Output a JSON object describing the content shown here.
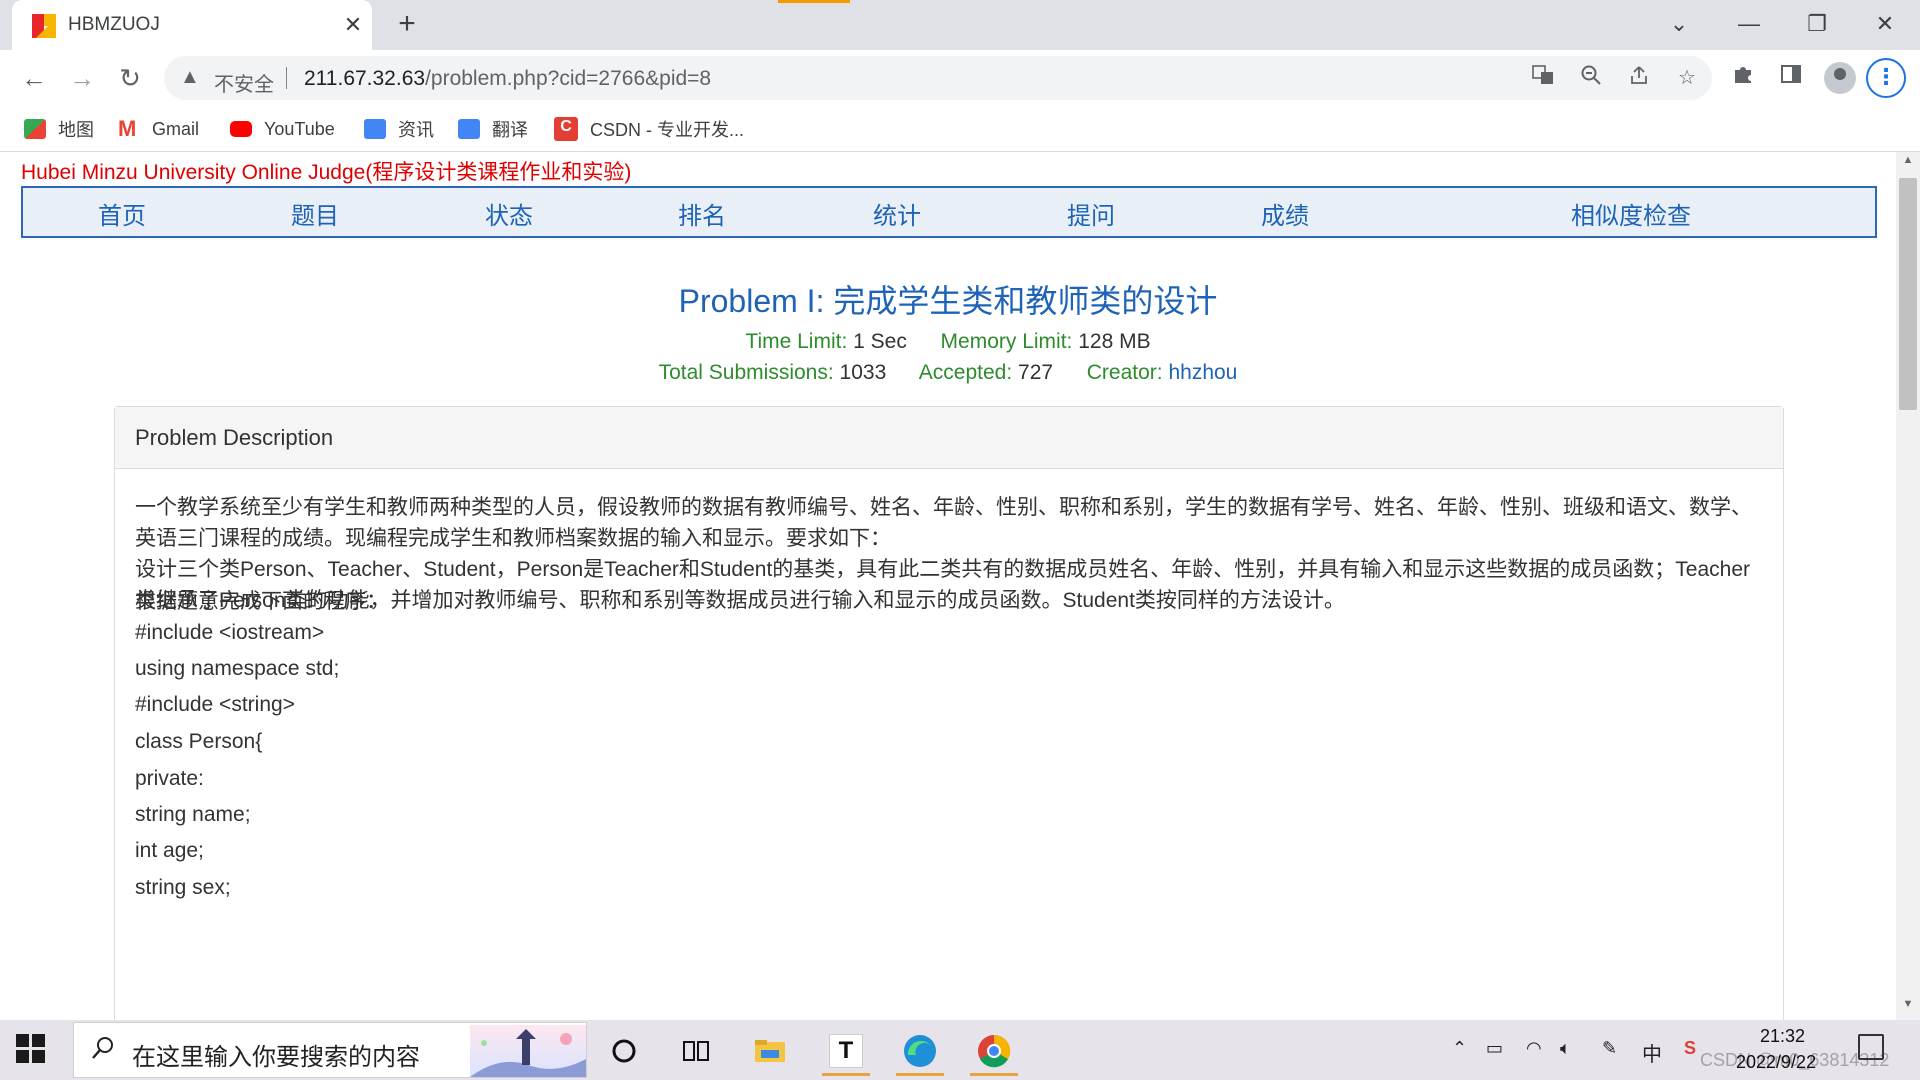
{
  "browser": {
    "tab_title": "HBMZUOJ",
    "tab_close": "✕",
    "new_tab": "+",
    "window": {
      "menu": "⌄",
      "minimize": "—",
      "restore": "❐",
      "close": "✕"
    },
    "security_label": "不安全",
    "url_host": "211.67.32.63",
    "url_path": "/problem.php?cid=2766&pid=8",
    "bookmarks": [
      {
        "label": "地图",
        "icon": "maps-icon",
        "color": "#34a853"
      },
      {
        "label": "Gmail",
        "icon": "gmail-icon",
        "color": "#ea4335"
      },
      {
        "label": "YouTube",
        "icon": "youtube-icon",
        "color": "#ff0000"
      },
      {
        "label": "资讯",
        "icon": "news-icon",
        "color": "#4285f4"
      },
      {
        "label": "翻译",
        "icon": "translate-icon",
        "color": "#4285f4"
      },
      {
        "label": "CSDN - 专业开发...",
        "icon": "csdn-icon",
        "color": "#e33e33"
      }
    ]
  },
  "site": {
    "title": "Hubei Minzu University Online Judge(程序设计类课程作业和实验)",
    "nav": [
      "首页",
      "题目",
      "状态",
      "排名",
      "统计",
      "提问",
      "成绩",
      "相似度检查"
    ]
  },
  "problem": {
    "title": "Problem I: 完成学生类和教师类的设计",
    "time_limit_label": "Time Limit:",
    "time_limit": "1 Sec",
    "memory_limit_label": "Memory Limit:",
    "memory_limit": "128 MB",
    "submissions_label": "Total Submissions:",
    "submissions": "1033",
    "accepted_label": "Accepted:",
    "accepted": "727",
    "creator_label": "Creator:",
    "creator": "hhzhou",
    "panel_heading": "Problem Description",
    "description": [
      "一个教学系统至少有学生和教师两种类型的人员，假设教师的数据有教师编号、姓名、年龄、性别、职称和系别，学生的数据有学号、姓名、年龄、性别、班级和语文、数学、英语三门课程的成绩。现编程完成学生和教师档案数据的输入和显示。要求如下：",
      "设计三个类Person、Teacher、Student，Person是Teacher和Student的基类，具有此二类共有的数据成员姓名、年龄、性别，并具有输入和显示这些数据的成员函数；Teacher类继承了Person类的功能，并增加对教师编号、职称和系别等数据成员进行输入和显示的成员函数。Student类按同样的方法设计。"
    ],
    "prompt": "根据题意完成下面的程序：",
    "code": [
      "#include <iostream>",
      "using namespace std;",
      "#include <string>",
      "class Person{",
      "private:",
      "string name;",
      "int age;",
      "string sex;"
    ]
  },
  "taskbar": {
    "search_placeholder": "在这里输入你要搜索的内容",
    "ime": "中",
    "time": "21:32",
    "date": "2022/9/22",
    "watermark": "CSDN @m0_63814312"
  },
  "colors": {
    "site_title": "#e00000",
    "nav_link": "#1f63b7",
    "label_green": "#2e8b2e",
    "accent_blue": "#1a73e8"
  }
}
